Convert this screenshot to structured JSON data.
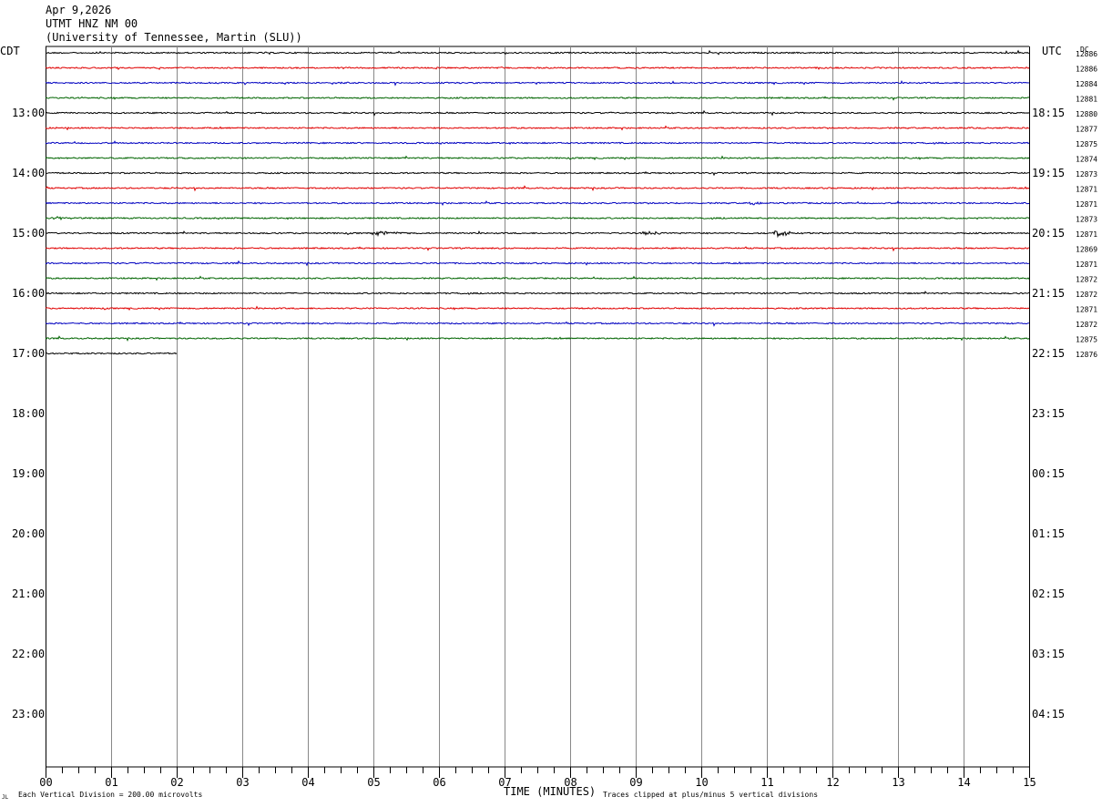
{
  "header": {
    "date": "Apr 9,2026",
    "station": "UTMT HNZ NM 00",
    "network": "(University of Tennessee, Martin (SLU))"
  },
  "chart_data": {
    "type": "helicorder",
    "left_timezone": "CDT",
    "right_timezone": "UTC",
    "dc_label": "DC",
    "xlabel": "TIME (MINUTES)",
    "x_ticks": [
      "00",
      "01",
      "02",
      "03",
      "04",
      "05",
      "06",
      "07",
      "08",
      "09",
      "10",
      "11",
      "12",
      "13",
      "14",
      "15"
    ],
    "xlim": [
      0,
      15
    ],
    "left_hour_labels": [
      "13:00",
      "14:00",
      "15:00",
      "16:00",
      "17:00",
      "18:00",
      "19:00",
      "20:00",
      "21:00",
      "22:00",
      "23:00"
    ],
    "right_hour_labels": [
      "18:15",
      "19:15",
      "20:15",
      "21:15",
      "22:15",
      "23:15",
      "00:15",
      "01:15",
      "02:15",
      "03:15",
      "04:15"
    ],
    "row_colors": [
      "#000000",
      "#e00000",
      "#0000c0",
      "#006400"
    ],
    "trace_dc_values": [
      "12886",
      "12886",
      "12884",
      "12881",
      "12880",
      "12877",
      "12875",
      "12874",
      "12873",
      "12871",
      "12871",
      "12873",
      "12871",
      "12869",
      "12871",
      "12872",
      "12872",
      "12871",
      "12872",
      "12875",
      "12876"
    ],
    "last_trace_end_minute": 2.0,
    "events": [
      {
        "trace": 12,
        "minute": 5.15,
        "amplitude": 3
      },
      {
        "trace": 12,
        "minute": 9.2,
        "amplitude": 2
      },
      {
        "trace": 12,
        "minute": 11.2,
        "amplitude": 5
      },
      {
        "trace": 2,
        "minute": 4.3,
        "amplitude": 1.5
      },
      {
        "trace": 10,
        "minute": 10.8,
        "amplitude": 1.5
      },
      {
        "trace": 11,
        "minute": 0.2,
        "amplitude": 2
      }
    ],
    "scale_note": "Each Vertical Division =  200.00 microvolts",
    "clip_note": "Traces clipped at plus/minus 5 vertical divisions"
  },
  "footer": {
    "corner_mark": "JL"
  }
}
